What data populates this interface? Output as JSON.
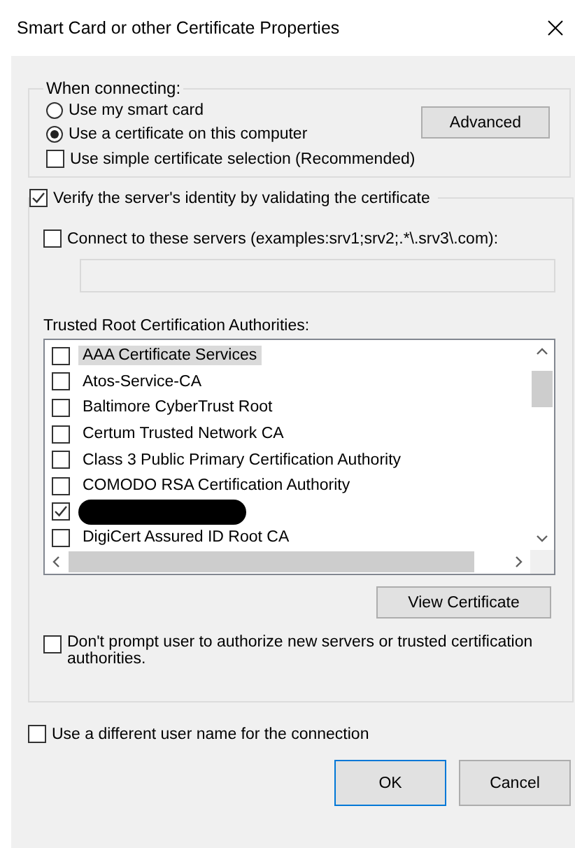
{
  "window": {
    "title": "Smart Card or other Certificate Properties"
  },
  "connecting": {
    "legend": "When connecting:",
    "options": [
      {
        "label": "Use my smart card",
        "selected": false
      },
      {
        "label": "Use a certificate on this computer",
        "selected": true
      }
    ],
    "advanced_button": "Advanced",
    "simple_selection": {
      "label": "Use simple certificate selection (Recommended)",
      "checked": false
    }
  },
  "verify": {
    "label": "Verify the server's identity by validating the certificate",
    "checked": true,
    "connect_servers": {
      "label": "Connect to these servers (examples:srv1;srv2;.*\\.srv3\\.com):",
      "checked": false
    },
    "trusted_roots_label": "Trusted Root Certification Authorities:",
    "certificates": [
      {
        "kind": "entry",
        "label": "AAA Certificate Services",
        "checked": false,
        "selected": true
      },
      {
        "kind": "entry",
        "label": "Atos-Service-CA",
        "checked": false,
        "selected": false
      },
      {
        "kind": "entry",
        "label": "Baltimore CyberTrust Root",
        "checked": false,
        "selected": false
      },
      {
        "kind": "entry",
        "label": "Certum Trusted Network CA",
        "checked": false,
        "selected": false
      },
      {
        "kind": "entry",
        "label": "Class 3 Public Primary Certification Authority",
        "checked": false,
        "selected": false
      },
      {
        "kind": "entry",
        "label": "COMODO RSA Certification Authority",
        "checked": false,
        "selected": false
      },
      {
        "kind": "redacted",
        "checked": true,
        "selected": false
      },
      {
        "kind": "entry",
        "label": "DigiCert Assured ID Root CA",
        "checked": false,
        "selected": false
      }
    ],
    "view_button": "View Certificate",
    "dont_prompt": {
      "label": "Don't prompt user to authorize new servers or trusted certification authorities.",
      "checked": false
    }
  },
  "different_user": {
    "label": "Use a different user name for the connection",
    "checked": false
  },
  "buttons": [
    {
      "label": "OK",
      "default": true
    },
    {
      "label": "Cancel",
      "default": false
    }
  ]
}
